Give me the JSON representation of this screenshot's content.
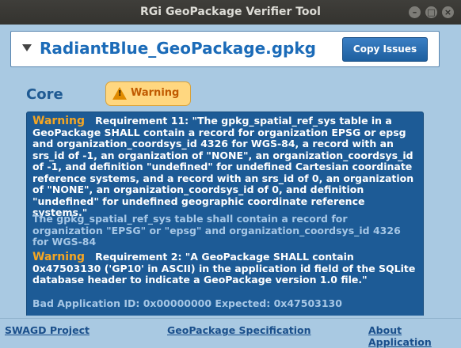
{
  "window": {
    "title": "RGi GeoPackage Verifier Tool"
  },
  "file": {
    "name": "RadiantBlue_GeoPackage.gpkg",
    "copy_label": "Copy Issues"
  },
  "section": {
    "name": "Core",
    "status": "Warning"
  },
  "issues": [
    {
      "level": "Warning",
      "requirement": "Requirement 11: \"The gpkg_spatial_ref_sys table in a GeoPackage SHALL contain a record for organization EPSG or epsg and organization_coordsys_id 4326 for WGS-84, a record with an srs_id of -1, an organization of \"NONE\", an organization_coordsys_id of -1, and definition \"undefined\" for undefined Cartesian coordinate reference systems, and a record with an srs_id of 0, an organization of \"NONE\", an organization_coordsys_id of 0, and definition \"undefined\" for undefined geographic coordinate reference systems.\"",
      "message": "The gpkg_spatial_ref_sys table shall contain a record for organization \"EPSG\" or \"epsg\" and organization_coordsys_id 4326 for WGS-84"
    },
    {
      "level": "Warning",
      "requirement": "Requirement 2: \"A GeoPackage SHALL contain 0x47503130 ('GP10' in ASCII) in the application id field of the SQLite database header to indicate a GeoPackage version 1.0 file.\"",
      "message": "Bad Application ID: 0x00000000 Expected: 0x47503130"
    }
  ],
  "footer": {
    "swagd": "SWAGD Project",
    "spec": "GeoPackage Specification",
    "about": "About Application"
  },
  "colors": {
    "accent": "#1b6bb8",
    "warning": "#f5a623",
    "panel": "#1d5b96",
    "background": "#a9c9e2"
  }
}
